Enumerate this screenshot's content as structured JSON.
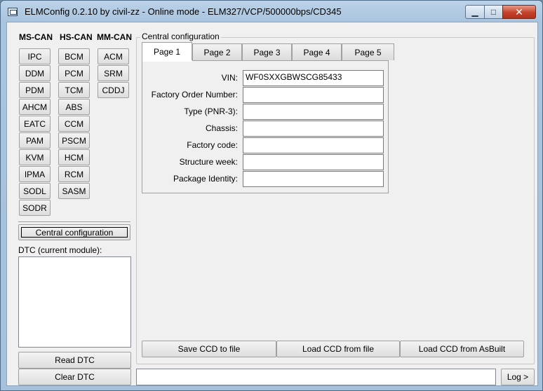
{
  "window": {
    "title": "ELMConfig 0.2.10 by civil-zz - Online mode - ELM327/VCP/500000bps/CD345",
    "min_symbol": "▁",
    "max_symbol": "□",
    "close_symbol": "✕"
  },
  "modules": {
    "ms_can_header": "MS-CAN",
    "hs_can_header": "HS-CAN",
    "mm_can_header": "MM-CAN",
    "ms_can": [
      "IPC",
      "DDM",
      "PDM",
      "AHCM",
      "EATC",
      "PAM",
      "KVM",
      "IPMA",
      "SODL",
      "SODR"
    ],
    "hs_can": [
      "BCM",
      "PCM",
      "TCM",
      "ABS",
      "CCM",
      "PSCM",
      "HCM",
      "RCM",
      "SASM"
    ],
    "mm_can": [
      "ACM",
      "SRM",
      "CDDJ"
    ]
  },
  "central_button": "Central configuration",
  "dtc": {
    "label": "DTC (current module):",
    "read_button": "Read DTC",
    "clear_button": "Clear DTC"
  },
  "central_config": {
    "group_label": "Central configuration",
    "tabs": [
      "Page 1",
      "Page 2",
      "Page 3",
      "Page 4",
      "Page 5"
    ],
    "active_tab": "Page 1",
    "fields": [
      {
        "label": "VIN:",
        "value": "WF0SXXGBWSCG85433"
      },
      {
        "label": "Factory Order Number:",
        "value": ""
      },
      {
        "label": "Type (PNR-3):",
        "value": ""
      },
      {
        "label": "Chassis:",
        "value": ""
      },
      {
        "label": "Factory code:",
        "value": ""
      },
      {
        "label": "Structure week:",
        "value": ""
      },
      {
        "label": "Package Identity:",
        "value": ""
      }
    ],
    "save_button": "Save CCD to file",
    "load_file_button": "Load CCD from file",
    "load_asbuilt_button": "Load CCD from AsBuilt"
  },
  "log": {
    "input_value": "",
    "button": "Log >"
  }
}
